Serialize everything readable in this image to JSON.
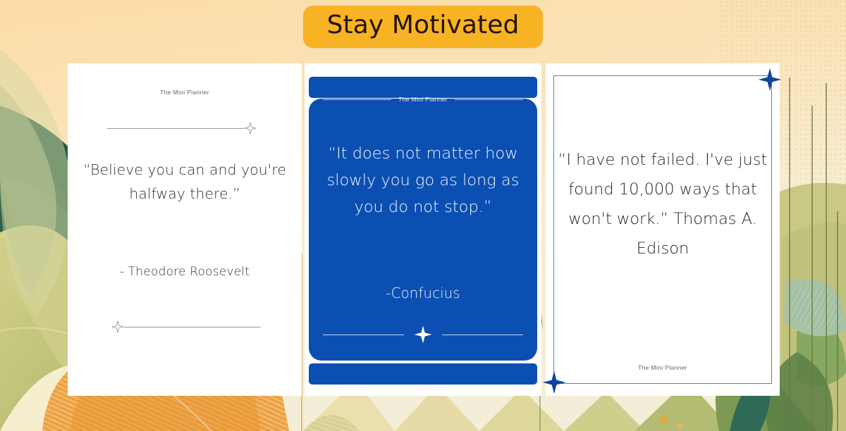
{
  "header": {
    "badge_label": "Stay Motivated",
    "badge_color": "#f7b323",
    "badge_text_color": "#231208"
  },
  "theme": {
    "page_background_top": "#fbe0b0",
    "page_background_mid": "#f7edd2",
    "card_blue": "#0b4fb2",
    "frame_border": "#5d7f98",
    "leaf_dark_green": "#2c6149",
    "leaf_olive": "#c3c57e",
    "leaf_sage": "#9fbfa4",
    "leaf_cream": "#f4ebc8",
    "accent_orange": "#e8912a",
    "text_dark": "#2f2f33"
  },
  "cards": [
    {
      "id": "card-roosevelt",
      "style": "white-minimal",
      "brand": "The Mini Planner",
      "quote": "“Believe you can and you're halfway there.”",
      "author": "-  Theodore Roosevelt",
      "divider_top_icon": "sparkle-icon",
      "divider_bottom_icon": "sparkle-icon"
    },
    {
      "id": "card-confucius",
      "style": "blue-filled",
      "brand": "The Mini Planner",
      "quote": "“It does not matter how slowly you go as long as you do not stop.”",
      "author": "-Confucius",
      "footer_icon": "sparkle-icon"
    },
    {
      "id": "card-edison",
      "style": "framed",
      "brand": "The Mini Planner",
      "quote": "“I have not failed. I've just found 10,000 ways that won't work.”",
      "author": "Thomas A. Edison",
      "corner_icon_top_right": "sparkle-icon",
      "corner_icon_bottom_left": "sparkle-icon"
    }
  ]
}
